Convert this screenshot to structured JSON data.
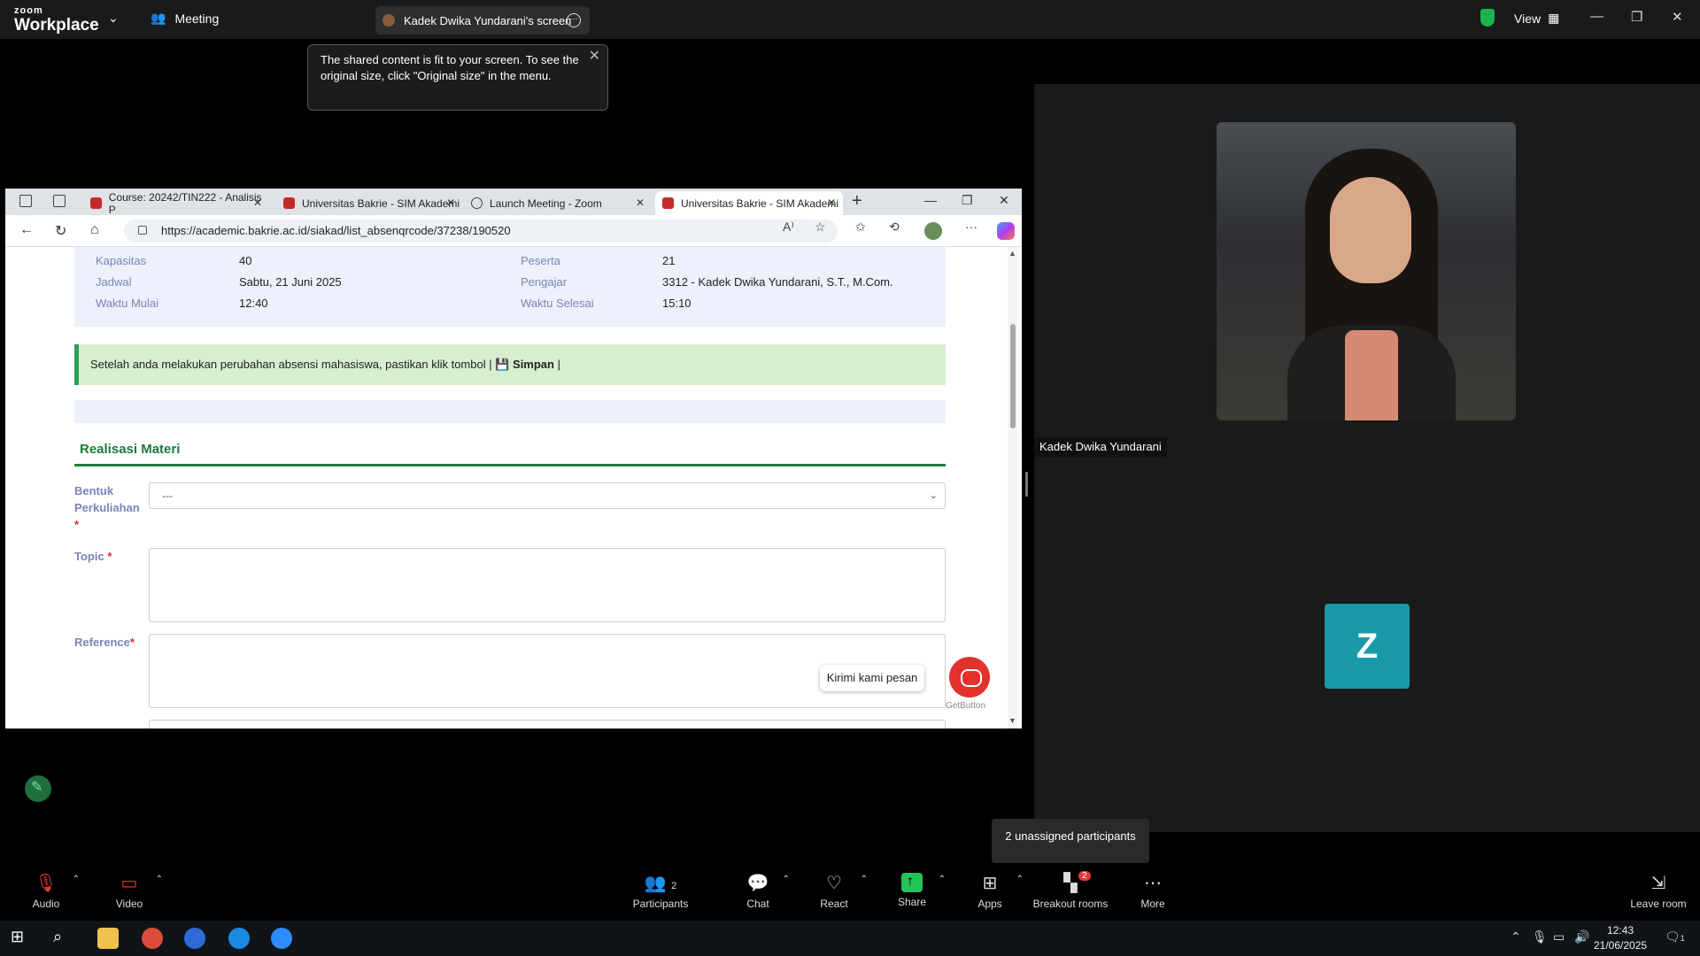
{
  "zoom": {
    "logo_top": "zoom",
    "logo_bottom": "Workplace",
    "meeting_label": "Meeting",
    "screen_label": "Kadek Dwika Yundarani's screen",
    "view_label": "View",
    "tooltip": "The shared content is fit to your screen. To see the original size, click \"Original size\" in the menu.",
    "participant_name": "Kadek Dwika Yundarani",
    "z_initial": "Z",
    "unassigned": "2 unassigned participants",
    "toolbar": {
      "audio": "Audio",
      "video": "Video",
      "participants": "Participants",
      "participants_count": "2",
      "chat": "Chat",
      "react": "React",
      "share": "Share",
      "apps": "Apps",
      "breakout": "Breakout rooms",
      "breakout_badge": "2",
      "more": "More",
      "leave": "Leave room"
    }
  },
  "browser": {
    "tabs": [
      {
        "label": "Course: 20242/TIN222 - Analisis P"
      },
      {
        "label": "Universitas Bakrie - SIM Akademi"
      },
      {
        "label": "Launch Meeting - Zoom"
      },
      {
        "label": "Universitas Bakrie - SIM Akademi"
      }
    ],
    "url": "https://academic.bakrie.ac.id/siakad/list_absenqrcode/37238/190520"
  },
  "page": {
    "info": {
      "kapasitas_label": "Kapasitas",
      "kapasitas": "40",
      "jadwal_label": "Jadwal",
      "jadwal": "Sabtu, 21 Juni 2025",
      "mulai_label": "Waktu Mulai",
      "mulai": "12:40",
      "peserta_label": "Peserta",
      "peserta": "21",
      "pengajar_label": "Pengajar",
      "pengajar": "3312 - Kadek Dwika Yundarani, S.T., M.Com.",
      "selesai_label": "Waktu Selesai",
      "selesai": "15:10"
    },
    "alert_text": "Setelah anda melakukan perubahan absensi mahasiswa, pastikan klik tombol |",
    "alert_bold": "💾 Simpan",
    "alert_tail": "|",
    "section_title": "Realisasi Materi",
    "bentuk_label_1": "Bentuk",
    "bentuk_label_2": "Perkuliahan",
    "required_mark": "*",
    "bentuk_value": "---",
    "topic_label": "Topic",
    "reference_label": "Reference",
    "kirim": "Kirimi kami pesan",
    "getbutton": "GetButton"
  },
  "taskbar": {
    "time": "12:43",
    "date": "21/06/2025",
    "notif_count": "1"
  }
}
